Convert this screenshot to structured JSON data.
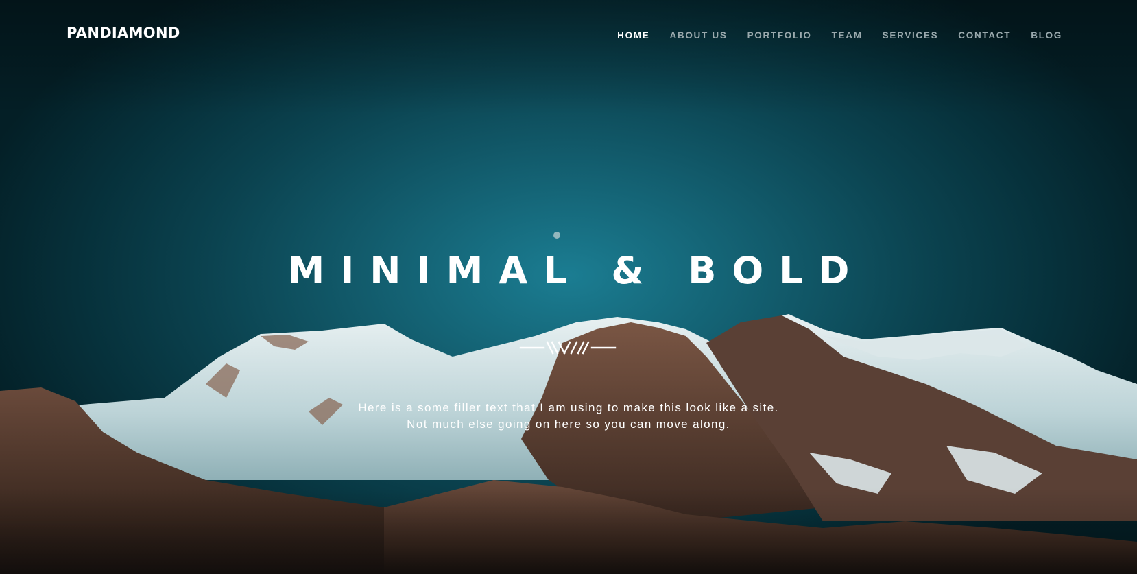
{
  "brand": {
    "name": "PANDIAMOND"
  },
  "nav": {
    "items": [
      {
        "label": "HOME",
        "active": true
      },
      {
        "label": "ABOUT US",
        "active": false
      },
      {
        "label": "PORTFOLIO",
        "active": false
      },
      {
        "label": "TEAM",
        "active": false
      },
      {
        "label": "SERVICES",
        "active": false
      },
      {
        "label": "CONTACT",
        "active": false
      },
      {
        "label": "BLOG",
        "active": false
      }
    ]
  },
  "hero": {
    "headline": "MINIMAL & BOLD",
    "subtext_line1": "Here is a some filler text that I am using to make this look like a site.",
    "subtext_line2": "Not much else going on here so you can move along.",
    "divider_icon": "chevron-ornament-divider"
  },
  "colors": {
    "sky_center": "#1b7d92",
    "sky_edge": "#041f26",
    "text_primary": "#ffffff",
    "nav_inactive": "#9aa9ad",
    "snow": "#dfe9ea",
    "rock": "#6b4a3a"
  }
}
